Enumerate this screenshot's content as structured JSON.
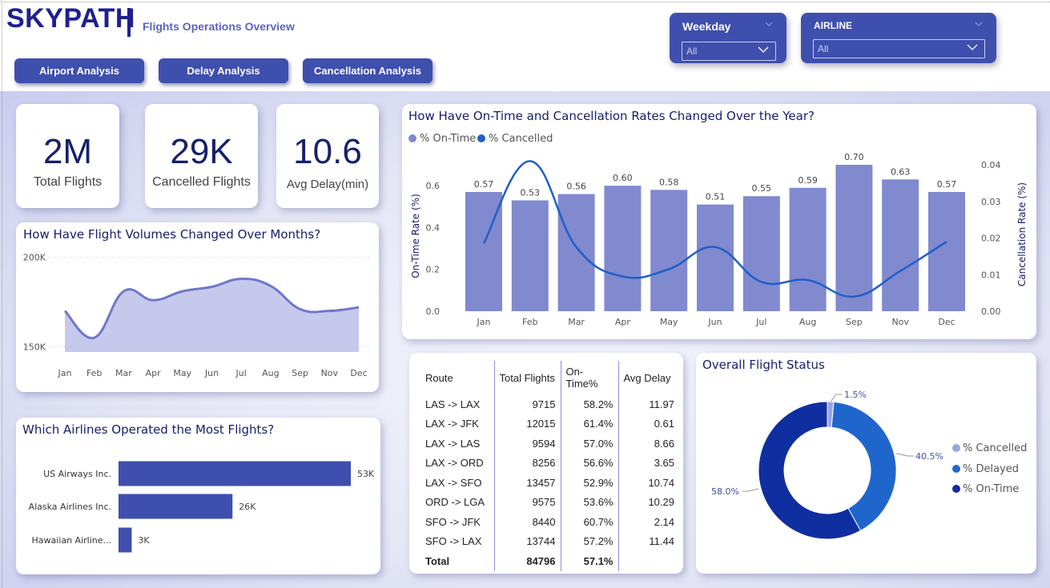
{
  "header": {
    "brand": "SKYPATH",
    "separator": "|",
    "subtitle": "Flights Operations Overview",
    "nav_buttons": [
      "Airport Analysis",
      "Delay Analysis",
      "Cancellation Analysis"
    ]
  },
  "slicers": [
    {
      "title": "Weekday",
      "value": "All"
    },
    {
      "title": "AIRLINE",
      "value": "All"
    }
  ],
  "kpis": [
    {
      "value": "2M",
      "label": "Total Flights"
    },
    {
      "value": "29K",
      "label": "Cancelled Flights"
    },
    {
      "value": "10.6",
      "label": "Avg Delay(min)"
    }
  ],
  "colors": {
    "navy": "#17206b",
    "accent": "#3f4fad",
    "bar_light": "#8189cf",
    "line_blue": "#1f5fc7",
    "donut_cancelled": "#9aa6dd",
    "donut_delayed": "#1f66cc",
    "donut_ontime": "#0f2ea0"
  },
  "chart_data": [
    {
      "type": "area",
      "title": "How Have Flight Volumes Changed Over Months?",
      "categories": [
        "Jan",
        "Feb",
        "Mar",
        "Apr",
        "May",
        "Jun",
        "Jul",
        "Aug",
        "Sep",
        "Nov",
        "Dec"
      ],
      "values": [
        170000,
        155000,
        181000,
        176000,
        181000,
        183500,
        188000,
        184000,
        171000,
        170000,
        172000
      ],
      "ylim": [
        147000,
        203000
      ],
      "y_ticks": [
        {
          "value": 150000,
          "label": "150K"
        },
        {
          "value": 200000,
          "label": "200K"
        }
      ],
      "grid": true
    },
    {
      "type": "bar",
      "title": "How Have On-Time and Cancellation Rates Changed Over the Year?",
      "categories": [
        "Jan",
        "Feb",
        "Mar",
        "Apr",
        "May",
        "Jun",
        "Jul",
        "Aug",
        "Sep",
        "Nov",
        "Dec"
      ],
      "series": [
        {
          "name": "% On-Time",
          "type": "bar",
          "axis": "left",
          "values": [
            0.57,
            0.53,
            0.56,
            0.6,
            0.58,
            0.51,
            0.55,
            0.59,
            0.7,
            0.63,
            0.57
          ]
        },
        {
          "name": "% Cancelled",
          "type": "line",
          "axis": "right",
          "values": [
            0.0185,
            0.041,
            0.0175,
            0.0095,
            0.0115,
            0.0175,
            0.008,
            0.0085,
            0.004,
            0.011,
            0.019
          ]
        }
      ],
      "ylabel": "On-Time Rate (%)",
      "y2label": "Cancellation Rate (%)",
      "ylim": [
        0,
        0.7
      ],
      "y2lim": [
        0,
        0.04
      ],
      "y_ticks": [
        "0.0",
        "0.2",
        "0.4",
        "0.6"
      ],
      "y2_ticks": [
        "0.00",
        "0.01",
        "0.02",
        "0.03",
        "0.04"
      ],
      "legend": "top-left",
      "grid": false
    },
    {
      "type": "bar",
      "orientation": "horizontal",
      "title": "Which Airlines Operated the Most Flights?",
      "categories": [
        "US Airways Inc.",
        "Alaska Airlines Inc.",
        "Hawaiian Airline..."
      ],
      "values": [
        53000,
        26000,
        3000
      ],
      "labels": [
        "53K",
        "26K",
        "3K"
      ]
    },
    {
      "type": "pie",
      "donut": true,
      "title": "Overall Flight Status",
      "categories": [
        "% Cancelled",
        "% Delayed",
        "% On-Time"
      ],
      "values": [
        1.5,
        40.5,
        58.0
      ],
      "labels": [
        "1.5%",
        "40.5%",
        "58.0%"
      ],
      "legend": "right"
    }
  ],
  "route_table": {
    "headers": [
      "Route",
      "Total Flights",
      "On-Time%",
      "Avg Delay"
    ],
    "rows": [
      [
        "LAS -> LAX",
        "9715",
        "58.2%",
        "11.97"
      ],
      [
        "LAX -> JFK",
        "12015",
        "61.4%",
        "0.61"
      ],
      [
        "LAX -> LAS",
        "9594",
        "57.0%",
        "8.66"
      ],
      [
        "LAX -> ORD",
        "8256",
        "56.6%",
        "3.65"
      ],
      [
        "LAX -> SFO",
        "13457",
        "52.9%",
        "10.74"
      ],
      [
        "ORD -> LGA",
        "9575",
        "53.6%",
        "10.29"
      ],
      [
        "SFO -> JFK",
        "8440",
        "60.7%",
        "2.14"
      ],
      [
        "SFO -> LAX",
        "13744",
        "57.2%",
        "11.44"
      ]
    ],
    "total": [
      "Total",
      "84796",
      "57.1%",
      ""
    ]
  }
}
